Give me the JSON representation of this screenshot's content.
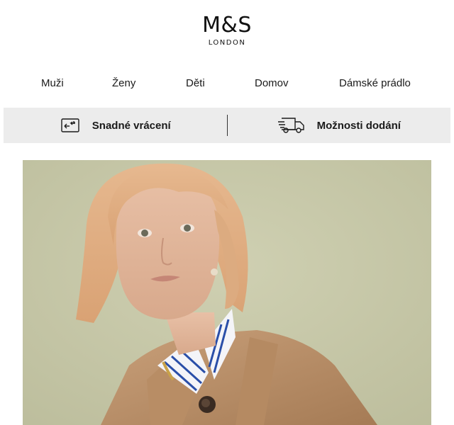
{
  "brand": {
    "name": "M&S",
    "subtitle": "LONDON"
  },
  "nav": {
    "items": [
      {
        "label": "Muži"
      },
      {
        "label": "Ženy"
      },
      {
        "label": "Děti"
      },
      {
        "label": "Domov"
      },
      {
        "label": "Dámské prádlo"
      }
    ]
  },
  "benefits": {
    "returns_label": "Snadné vrácení",
    "returns_icon": "return-box-icon",
    "delivery_label": "Možnosti dodání",
    "delivery_icon": "delivery-truck-icon"
  },
  "hero": {
    "image": "model-in-trench-coat-photo",
    "background_color": "#c8c8a8"
  }
}
